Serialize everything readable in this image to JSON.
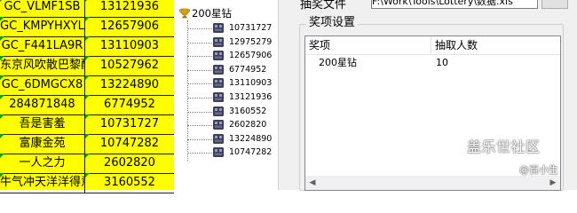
{
  "sheet": {
    "rows": [
      {
        "name": "GC_VLMF1SB",
        "id": "13121936"
      },
      {
        "name": "GC_KMPYHXYL",
        "id": "12657906"
      },
      {
        "name": "GC_F441LA9R",
        "id": "13110903"
      },
      {
        "name": "东京风吹散巴黎酮",
        "id": "10527962"
      },
      {
        "name": "GC_6DMGCX8",
        "id": "13224890"
      },
      {
        "name": "284871848",
        "id": "6774952"
      },
      {
        "name": "吾是害羞",
        "id": "10731727"
      },
      {
        "name": "富康金苑",
        "id": "10747282"
      },
      {
        "name": "一人之力",
        "id": "2602820"
      },
      {
        "name": "牛气冲天洋洋得意",
        "id": "3160552"
      }
    ],
    "colors": {
      "fill": "#ffff00",
      "marker": "#00a000"
    }
  },
  "tree": {
    "root_label": "200星钻",
    "root_icon": "trophy-icon",
    "leaf_icon": "tree-node-icon",
    "leaves": [
      "10731727",
      "12975279",
      "12657906",
      "6774952",
      "13110903",
      "13121936",
      "3160552",
      "2602820",
      "13224890",
      "10747282"
    ]
  },
  "dialog": {
    "file_label": "抽奖文件",
    "file_path": "F:\\Work\\Tools\\Lottery\\数据.xls",
    "group_title": "奖项设置",
    "columns": [
      "奖项",
      "抽取人数"
    ],
    "rows": [
      {
        "prize": "200星钻",
        "count": "10"
      }
    ]
  },
  "watermark": {
    "line1": "盖乐世社区",
    "line2": "@百小生"
  }
}
